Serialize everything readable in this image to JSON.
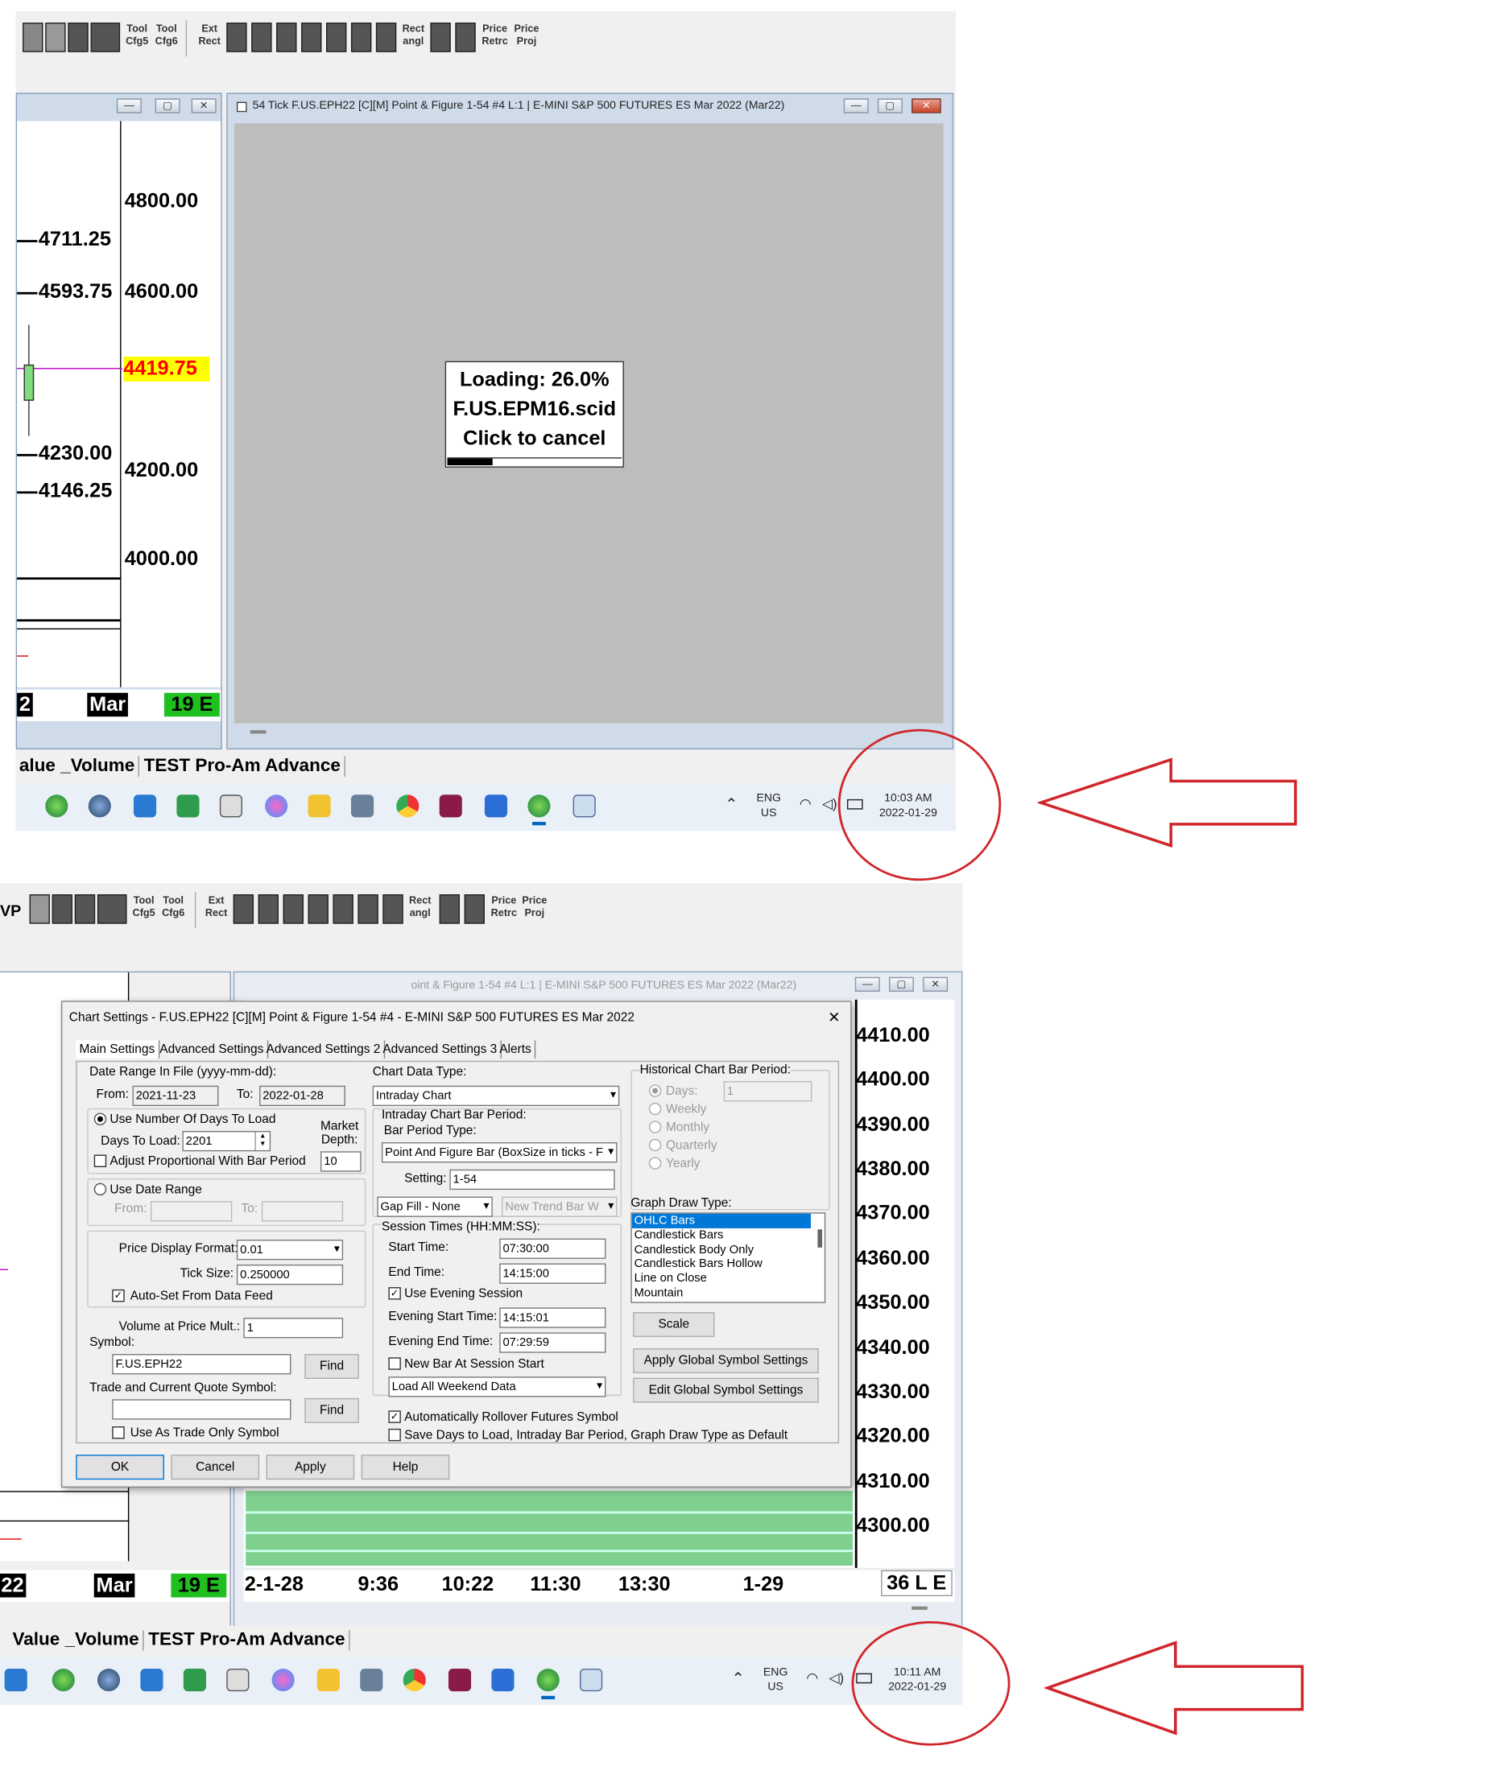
{
  "top": {
    "toolbar": {
      "tool_cfg5": "Tool Cfg5",
      "tool_cfg6": "Tool Cfg6",
      "ext_rect": "Ext Rect",
      "rect_angl": "Rect angl",
      "price_retrc": "Price Retrc",
      "price_proj": "Price Proj"
    },
    "left_chart": {
      "prices": [
        "4800.00",
        "4600.00",
        "4200.00",
        "4000.00"
      ],
      "levels": [
        "4711.25",
        "4593.75",
        "4230.00",
        "4146.25"
      ],
      "current": "4419.75",
      "x_labels": [
        "2",
        "Mar",
        "19 E"
      ]
    },
    "window": {
      "title": "54 Tick F.US.EPH22 [C][M]  Point & Figure 1-54  #4 L:1 | E-MINI S&P 500 FUTURES ES Mar 2022 (Mar22)"
    },
    "loading": {
      "line1": "Loading: 26.0%",
      "line2": "F.US.EPM16.scid",
      "line3": "Click to cancel",
      "progress": 0.26
    },
    "tabs": [
      "alue _Volume",
      "TEST Pro-Am Advance"
    ],
    "tray": {
      "lang1": "ENG",
      "lang2": "US",
      "time": "10:03 AM",
      "date": "2022-01-29"
    }
  },
  "bottom": {
    "toolbar": {
      "vp": "VP",
      "tool_cfg5": "Tool Cfg5",
      "tool_cfg6": "Tool Cfg6",
      "ext_rect": "Ext Rect",
      "rect_angl": "Rect angl",
      "price_retrc": "Price Retrc",
      "price_proj": "Price Proj"
    },
    "window": {
      "title": "oint & Figure 1-54  #4 L:1 | E-MINI S&P 500 FUTURES ES Mar 2022 (Mar22)"
    },
    "prices": [
      "4410.00",
      "4400.00",
      "4390.00",
      "4380.00",
      "4370.00",
      "4360.00",
      "4350.00",
      "4340.00",
      "4330.00",
      "4320.00",
      "4310.00",
      "4300.00"
    ],
    "x_labels": [
      "22",
      "Mar",
      "19 E",
      "2-1-28",
      "9:36",
      "10:22",
      "11:30",
      "13:30",
      "1-29",
      "36 L E"
    ],
    "tabs": [
      "Value _Volume",
      "TEST Pro-Am Advance"
    ],
    "tray": {
      "lang1": "ENG",
      "lang2": "US",
      "time": "10:11 AM",
      "date": "2022-01-29"
    },
    "dialog": {
      "title": "Chart Settings - F.US.EPH22 [C][M]  Point & Figure 1-54  #4 - E-MINI S&P 500 FUTURES ES Mar 2022",
      "close": "✕",
      "tabs": [
        "Main Settings",
        "Advanced Settings",
        "Advanced Settings 2",
        "Advanced Settings 3",
        "Alerts"
      ],
      "date_range_label": "Date Range In File (yyyy-mm-dd):",
      "from_label": "From:",
      "from": "2021-11-23",
      "to_label": "To:",
      "to": "2022-01-28",
      "use_days": "Use Number Of Days To Load",
      "days_to_load_label": "Days To Load:",
      "days_to_load": "2201",
      "market_depth_label1": "Market",
      "market_depth_label2": "Depth:",
      "market_depth": "10",
      "adjust_prop": "Adjust Proportional With Bar Period",
      "use_date_range": "Use Date Range",
      "dr_from": "From:",
      "dr_to": "To:",
      "price_display_label": "Price Display Format:",
      "price_display": "0.01",
      "tick_size_label": "Tick Size:",
      "tick_size": "0.250000",
      "auto_set": "Auto-Set From Data Feed",
      "vol_mult_label": "Volume at Price Mult.:",
      "vol_mult": "1",
      "symbol_label": "Symbol:",
      "symbol": "F.US.EPH22",
      "find": "Find",
      "trade_quote_label": "Trade and Current Quote Symbol:",
      "trade_quote": "",
      "find2": "Find",
      "use_trade_only": "Use As Trade Only Symbol",
      "chart_data_type_label": "Chart Data Type:",
      "chart_data_type": "Intraday Chart",
      "intraday_period_label": "Intraday Chart Bar Period:",
      "bar_period_type_label": "Bar Period Type:",
      "bar_period_type": "Point And Figure Bar (BoxSize in ticks - F",
      "setting_label": "Setting:",
      "setting": "1-54",
      "gap_fill": "Gap Fill - None",
      "new_trend": "New Trend Bar W",
      "session_times_label": "Session Times (HH:MM:SS):",
      "start_time_label": "Start Time:",
      "start_time": "07:30:00",
      "end_time_label": "End Time:",
      "end_time": "14:15:00",
      "use_evening": "Use Evening Session",
      "eve_start_label": "Evening Start Time:",
      "eve_start": "14:15:01",
      "eve_end_label": "Evening End Time:",
      "eve_end": "07:29:59",
      "new_bar_session": "New Bar At Session Start",
      "weekend": "Load All Weekend Data",
      "auto_rollover": "Automatically Rollover Futures Symbol",
      "save_default": "Save Days to Load, Intraday Bar Period, Graph Draw Type as Default",
      "hist_label": "Historical Chart Bar Period:",
      "hist_days": "Days:",
      "hist_days_val": "1",
      "hist_weekly": "Weekly",
      "hist_monthly": "Monthly",
      "hist_quarterly": "Quarterly",
      "hist_yearly": "Yearly",
      "graph_draw_label": "Graph Draw Type:",
      "graph_types": [
        "OHLC Bars",
        "Candlestick Bars",
        "Candlestick Body Only",
        "Candlestick Bars Hollow",
        "Line on Close",
        "Mountain"
      ],
      "scale": "Scale",
      "apply_global": "Apply Global Symbol Settings",
      "edit_global": "Edit Global Symbol Settings",
      "ok": "OK",
      "cancel": "Cancel",
      "apply": "Apply",
      "help": "Help"
    }
  },
  "colors": {
    "annotation": "#d0262b",
    "highlight": "#ffff00",
    "highlight_text": "#ff0000",
    "green_label": "#1fbf1f",
    "selection": "#0078d7"
  }
}
